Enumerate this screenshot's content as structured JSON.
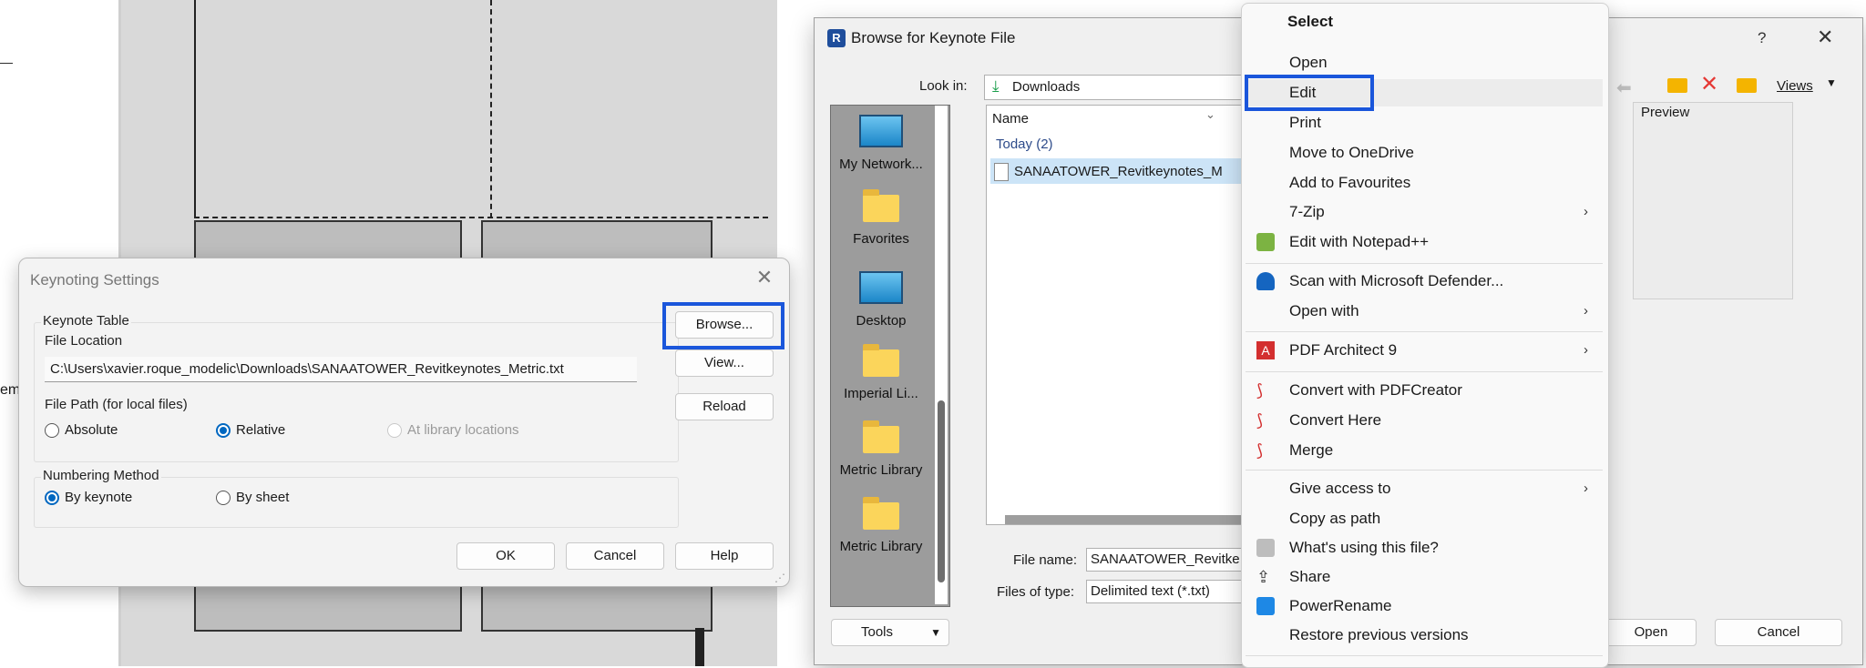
{
  "keynoting": {
    "title": "Keynoting Settings",
    "close": "✕",
    "table_group": "Keynote Table",
    "file_location_label": "File Location",
    "file_path": "C:\\Users\\xavier.roque_modelic\\Downloads\\SANAATOWER_Revitkeynotes_Metric.txt",
    "path_group": "File Path (for local files)",
    "absolute": "Absolute",
    "relative": "Relative",
    "library": "At library locations",
    "browse": "Browse...",
    "view": "View...",
    "reload": "Reload",
    "numbering_group": "Numbering Method",
    "by_keynote": "By keynote",
    "by_sheet": "By sheet",
    "ok": "OK",
    "cancel": "Cancel",
    "help": "Help"
  },
  "browse": {
    "title": "Browse for Keynote File",
    "help_icon": "?",
    "close": "✕",
    "look_in_label": "Look in:",
    "look_in_value": "Downloads",
    "views": "Views",
    "preview": "Preview",
    "places": [
      "My Network...",
      "Favorites",
      "Desktop",
      "Imperial Li...",
      "Metric Library",
      "Metric Library"
    ],
    "column_name": "Name",
    "group_today": "Today (2)",
    "file": "SANAATOWER_Revitkeynotes_M",
    "filename_label": "File name:",
    "filename_value": "SANAATOWER_Revitke",
    "filetype_label": "Files of type:",
    "filetype_value": "Delimited text (*.txt)",
    "tools": "Tools",
    "open": "Open",
    "cancel": "Cancel"
  },
  "context_menu": {
    "header": "Select",
    "items": [
      "Open",
      "Edit",
      "Print",
      "Move to OneDrive",
      "Add to Favourites",
      "7-Zip",
      "Edit with Notepad++",
      "Scan with Microsoft Defender...",
      "Open with",
      "PDF Architect 9",
      "Convert with PDFCreator",
      "Convert Here",
      "Merge",
      "Give access to",
      "Copy as path",
      "What's using this file?",
      "Share",
      "PowerRename",
      "Restore previous versions"
    ],
    "submenu_arrow": "›"
  },
  "canvas": {
    "fragment_a": "—",
    "fragment_b": "em"
  },
  "colors": {
    "highlight": "#1a56db",
    "accent": "#0067c0"
  }
}
